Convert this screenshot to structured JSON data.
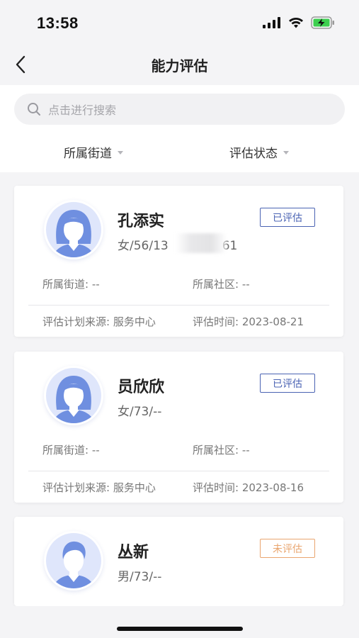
{
  "status_bar": {
    "time": "13:58"
  },
  "nav": {
    "title": "能力评估",
    "back_icon": "chevron-left-icon"
  },
  "search": {
    "placeholder": "点击进行搜索",
    "icon": "search-icon"
  },
  "filters": [
    {
      "label": "所属街道"
    },
    {
      "label": "评估状态"
    }
  ],
  "colors": {
    "accent": "#4a63b3",
    "pending": "#e9a56f",
    "avatar_blue": "#6f8fe0"
  },
  "cards": [
    {
      "name": "孔添实",
      "sub_left": "女/56/13",
      "sub_right": "61",
      "status": "已评估",
      "street_label": "所属街道: --",
      "community_label": "所属社区: --",
      "source_label": "评估计划来源: 服务中心",
      "time_label": "评估时间: 2023-08-21",
      "gender_icon": "female-avatar-icon"
    },
    {
      "name": "员欣欣",
      "sub": "女/73/--",
      "status": "已评估",
      "street_label": "所属街道: --",
      "community_label": "所属社区: --",
      "source_label": "评估计划来源: 服务中心",
      "time_label": "评估时间: 2023-08-16",
      "gender_icon": "female-avatar-icon"
    },
    {
      "name": "丛新",
      "sub": "男/73/--",
      "status": "未评估",
      "gender_icon": "male-avatar-icon"
    }
  ]
}
